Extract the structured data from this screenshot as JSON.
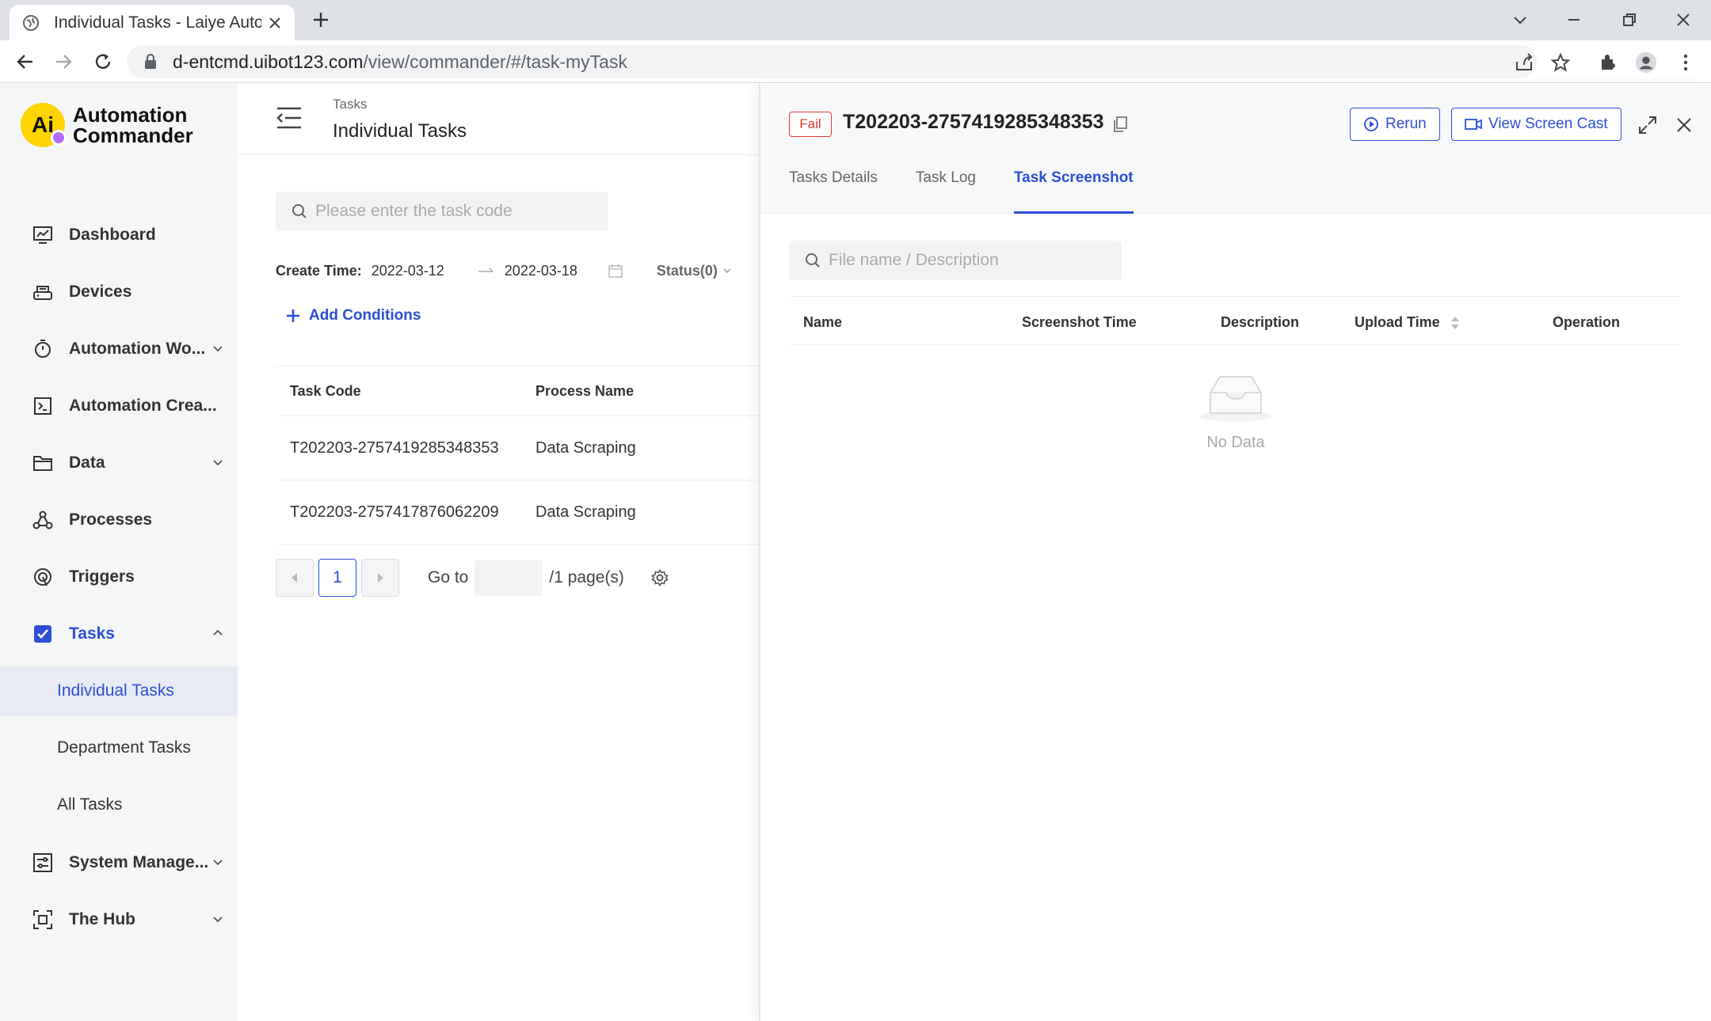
{
  "browser": {
    "tab_title": "Individual Tasks - Laiye Autom",
    "url_host": "d-entcmd.uibot123.com",
    "url_path": "/view/commander/#/task-myTask"
  },
  "app": {
    "logo_mark": "Ai",
    "logo_line1": "Automation",
    "logo_line2": "Commander",
    "accent_color": "#2d4fd6"
  },
  "sidebar": {
    "items": [
      {
        "label": "Dashboard",
        "icon": "dashboard-icon"
      },
      {
        "label": "Devices",
        "icon": "devices-icon"
      },
      {
        "label": "Automation Wo...",
        "icon": "automation-workflow-icon"
      },
      {
        "label": "Automation Crea...",
        "icon": "automation-creator-icon"
      },
      {
        "label": "Data",
        "icon": "folder-icon"
      },
      {
        "label": "Processes",
        "icon": "processes-icon"
      },
      {
        "label": "Triggers",
        "icon": "triggers-icon"
      },
      {
        "label": "Tasks",
        "icon": "tasks-checkbox-icon"
      },
      {
        "label": "System Manage...",
        "icon": "system-management-icon"
      },
      {
        "label": "The Hub",
        "icon": "hub-icon"
      }
    ],
    "sub_items": [
      "Individual Tasks",
      "Department Tasks",
      "All Tasks"
    ]
  },
  "main": {
    "breadcrumb": "Tasks",
    "title": "Individual Tasks",
    "search_placeholder": "Please enter the task code",
    "create_time_label": "Create Time:",
    "date_start": "2022-03-12",
    "date_end": "2022-03-18",
    "status_label": "Status(0)",
    "add_conditions": "Add Conditions",
    "columns": [
      "Task Code",
      "Process Name"
    ],
    "rows": [
      [
        "T202203-2757419285348353",
        "Data Scraping"
      ],
      [
        "T202203-2757417876062209",
        "Data Scraping"
      ]
    ],
    "pagination": {
      "current_page": "1",
      "goto_label": "Go to",
      "total_label": "/1 page(s)"
    }
  },
  "drawer": {
    "status_badge": "Fail",
    "title": "T202203-2757419285348353",
    "rerun_label": "Rerun",
    "screencast_label": "View Screen Cast",
    "tabs": [
      "Tasks Details",
      "Task Log",
      "Task Screenshot"
    ],
    "active_tab": "Task Screenshot",
    "search_placeholder": "File name / Description",
    "columns": [
      "Name",
      "Screenshot Time",
      "Description",
      "Upload Time",
      "Operation"
    ],
    "empty_text": "No Data"
  }
}
